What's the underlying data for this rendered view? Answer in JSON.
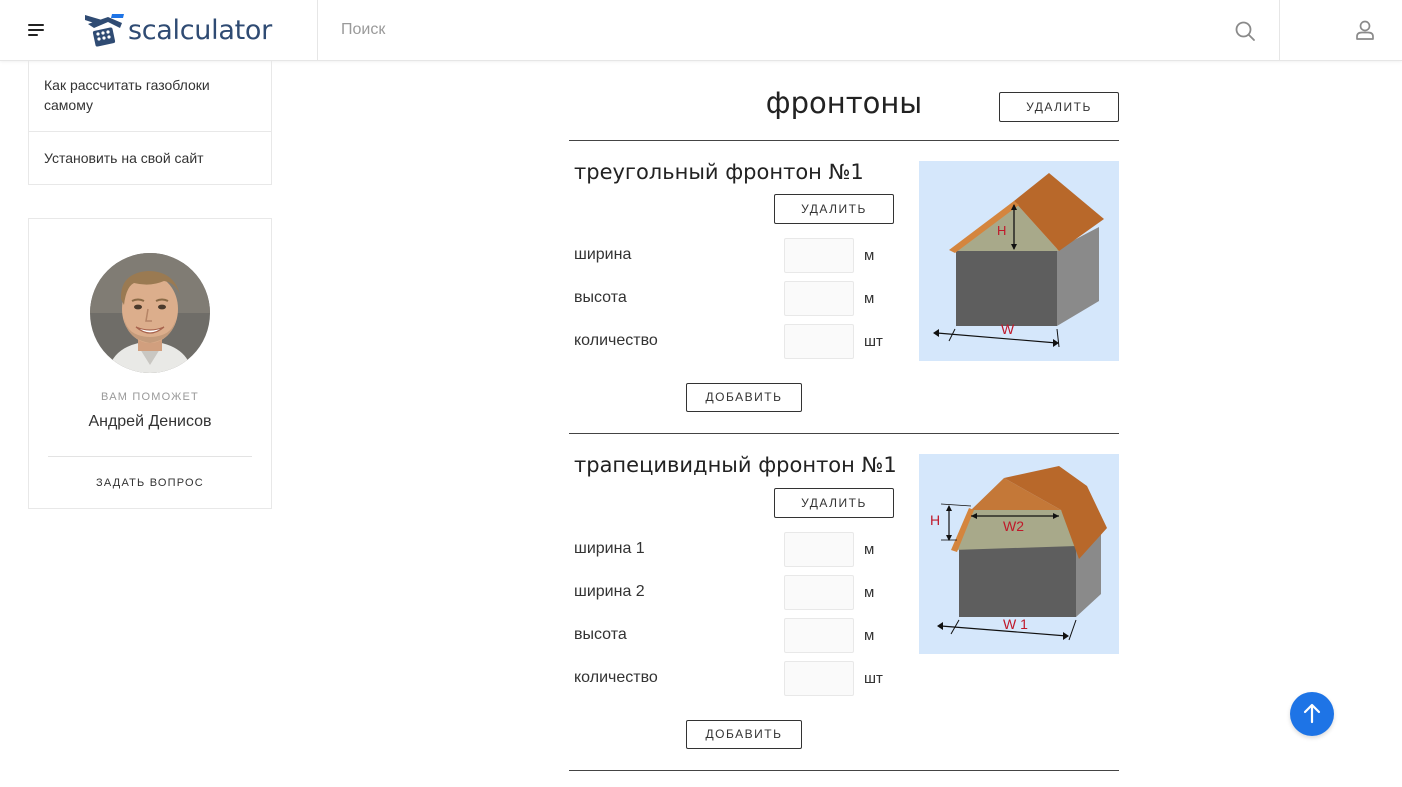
{
  "header": {
    "logo_text": "scalculator",
    "search_placeholder": "Поиск"
  },
  "sidebar": {
    "items": [
      {
        "label": "Как рассчитать газоблоки самому"
      },
      {
        "label": "Установить на свой сайт"
      }
    ],
    "helper": {
      "label": "ВАМ ПОМОЖЕТ",
      "name": "Андрей Денисов",
      "ask_label": "ЗАДАТЬ ВОПРОС"
    }
  },
  "main": {
    "title": "фронтоны",
    "delete_label": "УДАЛИТЬ",
    "sections": [
      {
        "title": "треугольный фронтон №1",
        "delete_label": "УДАЛИТЬ",
        "add_label": "ДОБАВИТЬ",
        "fields": [
          {
            "label": "ширина",
            "unit": "м",
            "value": ""
          },
          {
            "label": "высота",
            "unit": "м",
            "value": ""
          },
          {
            "label": "количество",
            "unit": "шт",
            "value": ""
          }
        ],
        "image_labels": {
          "h": "H",
          "w": "W"
        }
      },
      {
        "title": "трапецивидный фронтон №1",
        "delete_label": "УДАЛИТЬ",
        "add_label": "ДОБАВИТЬ",
        "fields": [
          {
            "label": "ширина 1",
            "unit": "м",
            "value": ""
          },
          {
            "label": "ширина 2",
            "unit": "м",
            "value": ""
          },
          {
            "label": "высота",
            "unit": "м",
            "value": ""
          },
          {
            "label": "количество",
            "unit": "шт",
            "value": ""
          }
        ],
        "image_labels": {
          "h": "H",
          "w2": "W2",
          "w1": "W 1"
        }
      }
    ]
  },
  "colors": {
    "accent": "#1e74e6",
    "logo": "#2f4b73",
    "roof": "#b8682a",
    "gable": "#a8a98a",
    "wall": "#5e5e5e",
    "diagram_bg": "#d5e7fb",
    "dimension_text": "#c0182a"
  },
  "icons": [
    "menu-icon",
    "search-icon",
    "user-icon",
    "arrow-up-icon"
  ]
}
